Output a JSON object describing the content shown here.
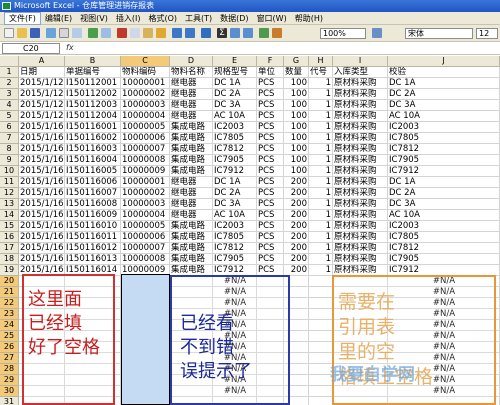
{
  "title": "Microsoft Excel - 仓库管理进销存报表",
  "menu": [
    "文件(F)",
    "编辑(E)",
    "视图(V)",
    "插入(I)",
    "格式(O)",
    "工具(T)",
    "数据(D)",
    "窗口(W)",
    "帮助(H)"
  ],
  "toolbar": {
    "zoom": "100%",
    "font": "宋体",
    "font_size": "12"
  },
  "formula": {
    "name_box": "C20",
    "fx": "fx"
  },
  "columns": [
    "A",
    "B",
    "C",
    "D",
    "E",
    "F",
    "G",
    "H",
    "I",
    "J"
  ],
  "headers": [
    "日期",
    "单据编号",
    "物料编码",
    "物料名称",
    "规格型号",
    "单位",
    "数量",
    "代号",
    "入库类型",
    "校验"
  ],
  "rows": [
    [
      "2015/1/12",
      "I150112001",
      "10000001",
      "继电器",
      "DC 1A",
      "PCS",
      "100",
      "1",
      "原材料采购",
      "DC 1A"
    ],
    [
      "2015/1/12",
      "I150112002",
      "10000002",
      "继电器",
      "DC 2A",
      "PCS",
      "100",
      "1",
      "原材料采购",
      "DC 2A"
    ],
    [
      "2015/1/12",
      "I150112003",
      "10000003",
      "继电器",
      "DC 3A",
      "PCS",
      "100",
      "1",
      "原材料采购",
      "DC 3A"
    ],
    [
      "2015/1/12",
      "I150112004",
      "10000004",
      "继电器",
      "AC 10A",
      "PCS",
      "100",
      "1",
      "原材料采购",
      "AC 10A"
    ],
    [
      "2015/1/16",
      "I150116001",
      "10000005",
      "集成电路",
      "IC2003",
      "PCS",
      "100",
      "1",
      "原材料采购",
      "IC2003"
    ],
    [
      "2015/1/16",
      "I150116002",
      "10000006",
      "集成电路",
      "IC7805",
      "PCS",
      "100",
      "1",
      "原材料采购",
      "IC7805"
    ],
    [
      "2015/1/16",
      "I150116003",
      "10000007",
      "集成电路",
      "IC7812",
      "PCS",
      "100",
      "1",
      "原材料采购",
      "IC7812"
    ],
    [
      "2015/1/16",
      "I150116004",
      "10000008",
      "集成电路",
      "IC7905",
      "PCS",
      "100",
      "1",
      "原材料采购",
      "IC7905"
    ],
    [
      "2015/1/16",
      "I150116005",
      "10000009",
      "集成电路",
      "IC7912",
      "PCS",
      "100",
      "1",
      "原材料采购",
      "IC7912"
    ],
    [
      "2015/1/16",
      "I150116006",
      "10000001",
      "继电器",
      "DC 1A",
      "PCS",
      "200",
      "1",
      "原材料采购",
      "DC 1A"
    ],
    [
      "2015/1/16",
      "I150116007",
      "10000002",
      "继电器",
      "DC 2A",
      "PCS",
      "200",
      "1",
      "原材料采购",
      "DC 2A"
    ],
    [
      "2015/1/16",
      "I150116008",
      "10000003",
      "继电器",
      "DC 3A",
      "PCS",
      "200",
      "1",
      "原材料采购",
      "DC 3A"
    ],
    [
      "2015/1/16",
      "I150116009",
      "10000004",
      "继电器",
      "AC 10A",
      "PCS",
      "200",
      "1",
      "原材料采购",
      "AC 10A"
    ],
    [
      "2015/1/16",
      "I150116010",
      "10000005",
      "集成电路",
      "IC2003",
      "PCS",
      "200",
      "1",
      "原材料采购",
      "IC2003"
    ],
    [
      "2015/1/16",
      "I150116011",
      "10000006",
      "集成电路",
      "IC7805",
      "PCS",
      "200",
      "1",
      "原材料采购",
      "IC7805"
    ],
    [
      "2015/1/16",
      "I150116012",
      "10000007",
      "集成电路",
      "IC7812",
      "PCS",
      "200",
      "1",
      "原材料采购",
      "IC7812"
    ],
    [
      "2015/1/16",
      "I150116013",
      "10000008",
      "集成电路",
      "IC7905",
      "PCS",
      "200",
      "1",
      "原材料采购",
      "IC7905"
    ],
    [
      "2015/1/16",
      "I150116014",
      "10000009",
      "集成电路",
      "IC7912",
      "PCS",
      "200",
      "1",
      "原材料采购",
      "IC7912"
    ]
  ],
  "empty_rows": [
    "20",
    "21",
    "22",
    "23",
    "24",
    "25",
    "26",
    "27",
    "28",
    "29",
    "30",
    "31"
  ],
  "na_text": "#N/A",
  "annotations": {
    "red": [
      "这里面",
      "已经填",
      "好了空格"
    ],
    "blue": [
      "已经看",
      "不到错",
      "误提示了"
    ],
    "orange": [
      "需要在",
      "引用表",
      "里的空",
      "格填上空格"
    ]
  },
  "watermark": "我要自学网"
}
